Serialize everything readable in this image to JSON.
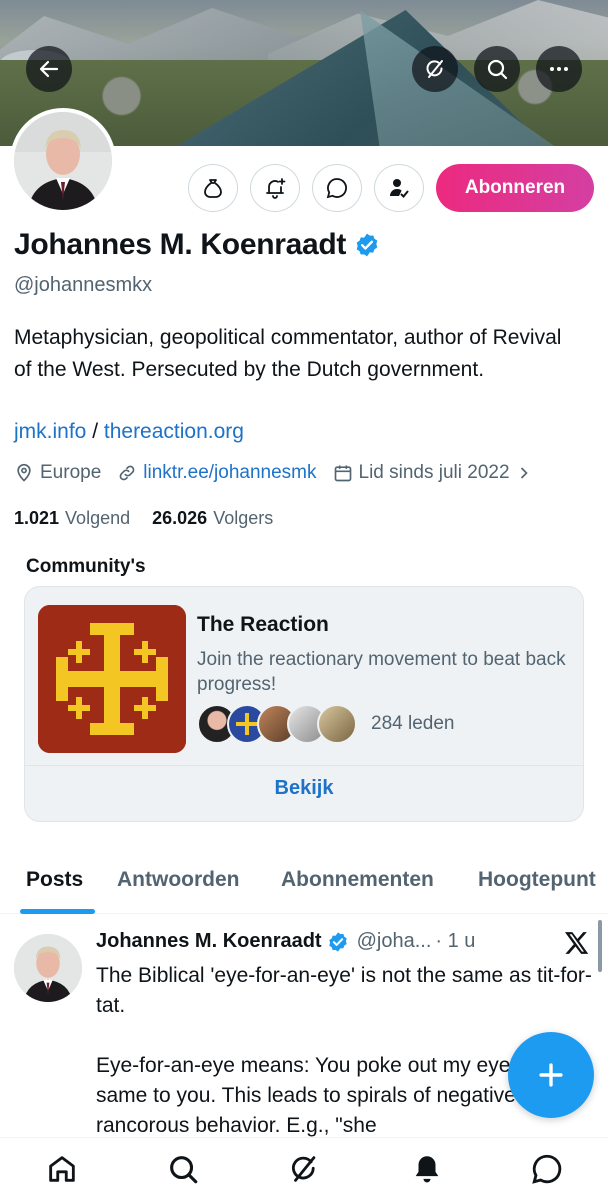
{
  "header": {
    "back_icon": "arrow-left-icon",
    "grok_icon": "grok-icon",
    "search_icon": "search-icon",
    "more_icon": "more-horizontal-icon"
  },
  "profile": {
    "name": "Johannes M. Koenraadt",
    "handle": "@johannesmkx",
    "bio": "Metaphysician, geopolitical commentator, author of Revival of the West. Persecuted by the Dutch government.",
    "link1": "jmk.info",
    "link_separator": " / ",
    "link2": "thereaction.org",
    "location": "Europe",
    "website": "linktr.ee/johannesmk",
    "joined": "Lid sinds juli 2022",
    "following_count": "1.021",
    "following_label": "Volgend",
    "followers_count": "26.026",
    "followers_label": "Volgers",
    "subscribe_label": "Abonneren"
  },
  "community": {
    "section_title": "Community's",
    "name": "The Reaction",
    "description": "Join the reactionary movement to beat back progress!",
    "members": "284 leden",
    "view_label": "Bekijk"
  },
  "tabs": [
    "Posts",
    "Antwoorden",
    "Abonnementen",
    "Hoogtepunt"
  ],
  "post": {
    "author": "Johannes M. Koenraadt",
    "handle": "@joha...",
    "time": "· 1 u",
    "text": "The Biblical 'eye-for-an-eye' is not the same as tit-for-tat.\n\nEye-for-an-eye means: You poke out my eye, I do the same to you. This leads to spirals of negative and rancorous behavior. E.g., \"she"
  },
  "colors": {
    "accent": "#1d9bf0",
    "link": "#1d72c9",
    "subscribe": "#ec2a7f",
    "muted": "#536471"
  },
  "nav": [
    "home-icon",
    "search-icon",
    "grok-icon",
    "notifications-icon",
    "messages-icon"
  ]
}
